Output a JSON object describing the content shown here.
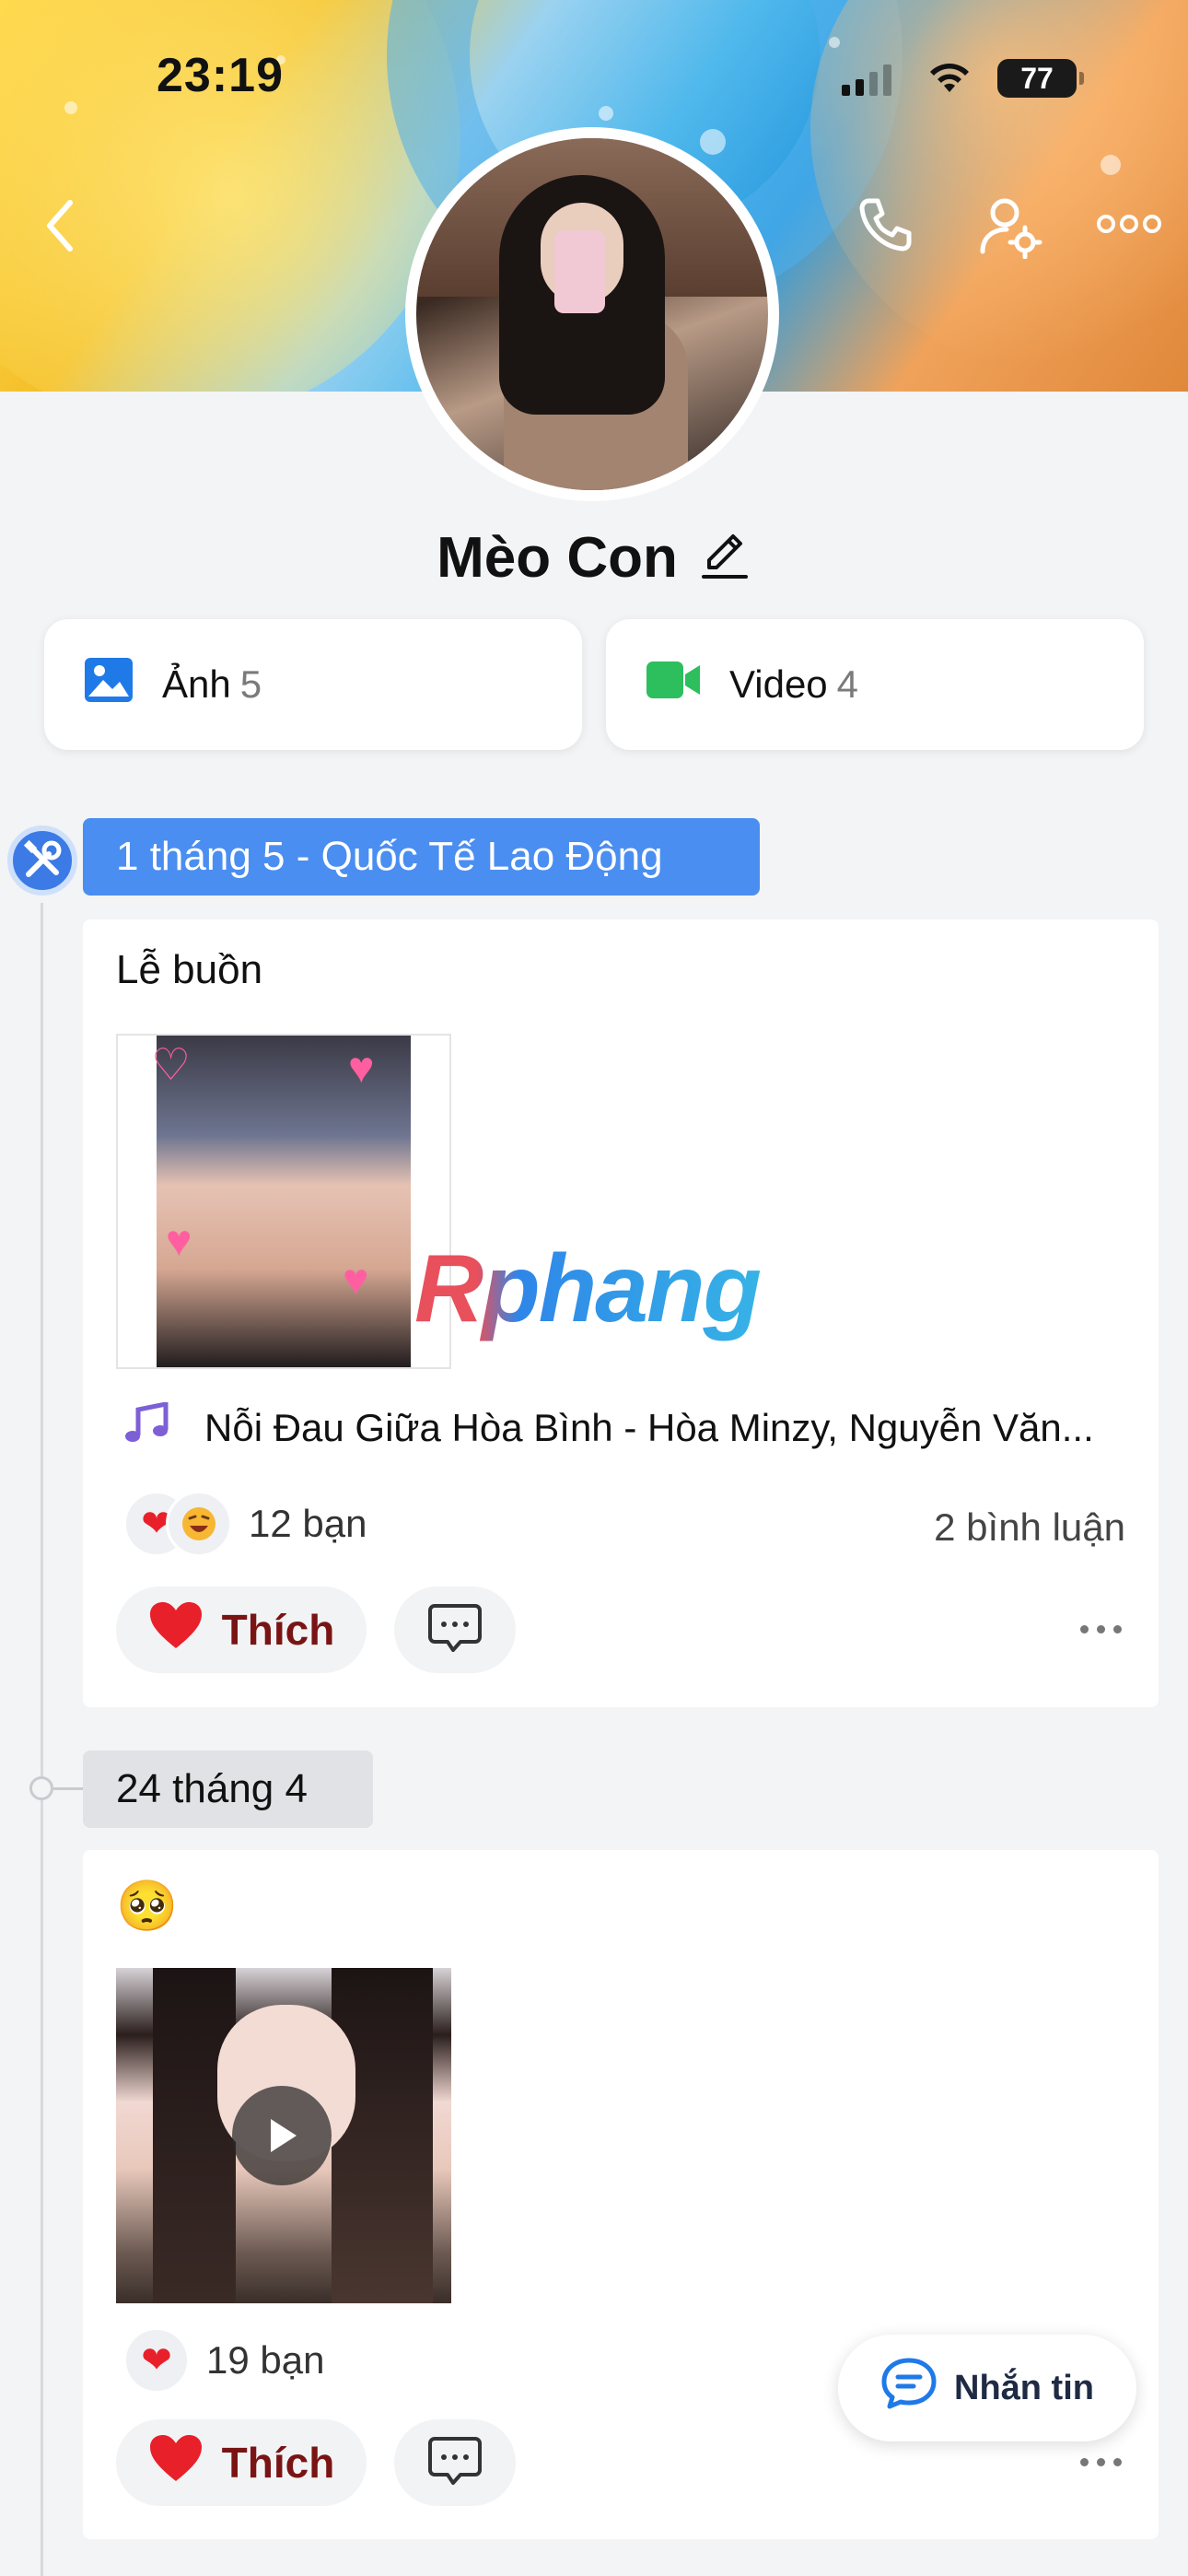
{
  "status_bar": {
    "time": "23:19",
    "battery": "77"
  },
  "profile": {
    "name": "Mèo Con"
  },
  "media": {
    "photos": {
      "label": "Ảnh",
      "count": "5"
    },
    "videos": {
      "label": "Video",
      "count": "4"
    }
  },
  "timeline": [
    {
      "date": "1 tháng 5 - Quốc Tế Lao Động",
      "post": {
        "text": "Lễ buồn",
        "music": "Nỗi Đau Giữa Hòa Bình - Hòa Minzy, Nguyễn Văn...",
        "reactions_label": "12 bạn",
        "comments_label": "2 bình luận",
        "like_label": "Thích"
      }
    },
    {
      "date": "24 tháng 4",
      "post": {
        "text": "🥺",
        "reactions_label": "19 bạn",
        "like_label": "Thích"
      }
    }
  ],
  "watermark": "Rphang",
  "fab": {
    "label": "Nhắn tin"
  },
  "colors": {
    "accent": "#4b8ef1",
    "like": "#7a1414",
    "heart": "#e8202a"
  },
  "icons": [
    "back-icon",
    "phone-icon",
    "profile-settings-icon",
    "more-icon",
    "edit-icon",
    "photo-icon",
    "video-icon",
    "tools-icon",
    "music-note-icon",
    "heart-icon",
    "laugh-emoji-icon",
    "comment-icon",
    "play-icon",
    "message-icon"
  ]
}
